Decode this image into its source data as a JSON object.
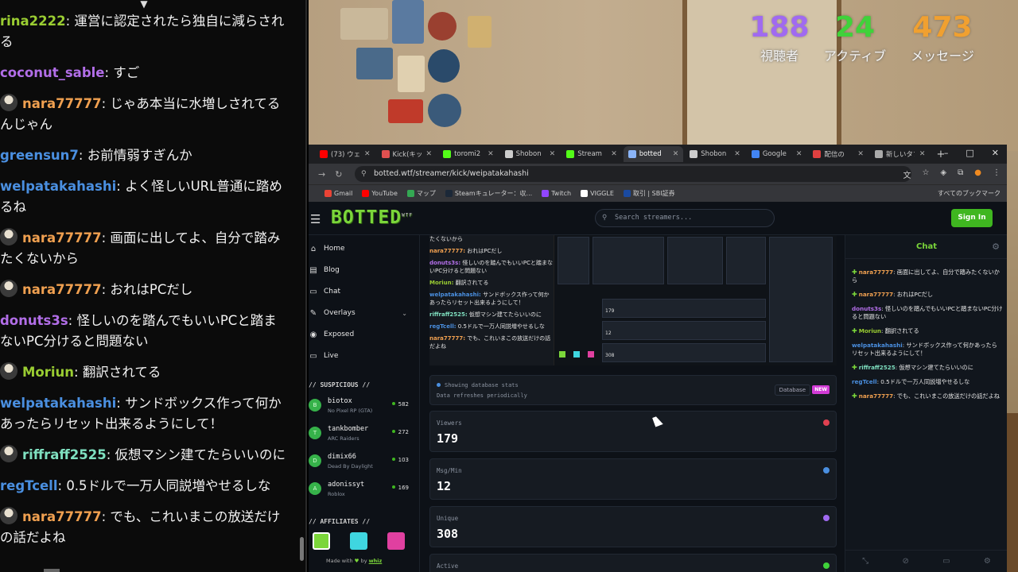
{
  "stream_chat": {
    "messages": [
      {
        "user": "rina2222",
        "color": "#9acd32",
        "avatar": false,
        "text": "運営に認定されたら独自に減らされる"
      },
      {
        "user": "coconut_sable",
        "color": "#b26ee8",
        "avatar": false,
        "text": "すご"
      },
      {
        "user": "nara77777",
        "color": "#f0a050",
        "avatar": true,
        "text": "じゃあ本当に水増しされてるんじゃん"
      },
      {
        "user": "greensun7",
        "color": "#4a8fe0",
        "avatar": false,
        "text": "お前情弱すぎんか"
      },
      {
        "user": "welpatakahashi",
        "color": "#4a8fe0",
        "avatar": false,
        "text": "よく怪しいURL普通に踏めるね"
      },
      {
        "user": "nara77777",
        "color": "#f0a050",
        "avatar": true,
        "text": "画面に出してよ、自分で踏みたくないから"
      },
      {
        "user": "nara77777",
        "color": "#f0a050",
        "avatar": true,
        "text": "おれはPCだし"
      },
      {
        "user": "donuts3s",
        "color": "#b26ee8",
        "avatar": false,
        "text": "怪しいのを踏んでもいいPCと踏まないPC分けると問題ない"
      },
      {
        "user": "Moriun",
        "color": "#9acd32",
        "avatar": true,
        "text": "翻訳されてる"
      },
      {
        "user": "welpatakahashi",
        "color": "#4a8fe0",
        "avatar": false,
        "text": "サンドボックス作って何かあったらリセット出来るようにして！"
      },
      {
        "user": "riffraff2525",
        "color": "#7fe0c0",
        "avatar": true,
        "text": "仮想マシン建てたらいいのに"
      },
      {
        "user": "regTcell",
        "color": "#4a8fe0",
        "avatar": false,
        "text": "0.5ドルで一万人同説増やせるしな"
      },
      {
        "user": "nara77777",
        "color": "#f0a050",
        "avatar": true,
        "text": "でも、これいまこの放送だけの話だよね"
      }
    ]
  },
  "overlay_stats": [
    {
      "value": "188",
      "label": "視聴者",
      "color": "#a06af0"
    },
    {
      "value": "24",
      "label": "アクティブ",
      "color": "#3fd23a"
    },
    {
      "value": "473",
      "label": "メッセージ",
      "color": "#f0a030"
    }
  ],
  "browser": {
    "tabs": [
      {
        "label": "(73) ウェ",
        "icon_color": "#ff0000",
        "active": false
      },
      {
        "label": "Kick(キッ",
        "icon_color": "#e05050",
        "active": false
      },
      {
        "label": "toromi2",
        "icon_color": "#53fc18",
        "active": false
      },
      {
        "label": "Shobon",
        "icon_color": "#cccccc",
        "active": false
      },
      {
        "label": "Stream",
        "icon_color": "#53fc18",
        "active": false
      },
      {
        "label": "botted",
        "icon_color": "#8ab4f8",
        "active": true
      },
      {
        "label": "Shobon",
        "icon_color": "#cccccc",
        "active": false
      },
      {
        "label": "Google",
        "icon_color": "#4285f4",
        "active": false
      },
      {
        "label": "配信の",
        "icon_color": "#e04040",
        "active": false
      },
      {
        "label": "新しいタブ",
        "icon_color": "#aaaaaa",
        "active": false
      }
    ],
    "new_tab": "+",
    "window_controls": [
      "–",
      "□",
      "✕"
    ],
    "url": "botted.wtf/streamer/kick/weipatakahashi",
    "bookmarks": [
      {
        "label": "Gmail",
        "icon_color": "#ea4335"
      },
      {
        "label": "YouTube",
        "icon_color": "#ff0000"
      },
      {
        "label": "マップ",
        "icon_color": "#34a853"
      },
      {
        "label": "Steamキュレーター：収...",
        "icon_color": "#1b2838"
      },
      {
        "label": "Twitch",
        "icon_color": "#9146ff"
      },
      {
        "label": "VIGGLE",
        "icon_color": "#ffffff"
      },
      {
        "label": "取引 | SBI証券",
        "icon_color": "#1a4aa0"
      }
    ],
    "all_bookmarks": "すべてのブックマーク"
  },
  "site": {
    "logo": "BOTTED",
    "logo_sup": "WTF",
    "search_placeholder": "Search streamers...",
    "signin": "Sign In",
    "nav": [
      {
        "label": "Home",
        "icon": "home-icon",
        "glyph": "⌂"
      },
      {
        "label": "Blog",
        "icon": "blog-icon",
        "glyph": "▤"
      },
      {
        "label": "Chat",
        "icon": "chat-icon",
        "glyph": "▭"
      },
      {
        "label": "Overlays",
        "icon": "overlays-icon",
        "glyph": "✎"
      },
      {
        "label": "Exposed",
        "icon": "eye-icon",
        "glyph": "◉"
      },
      {
        "label": "Live",
        "icon": "live-icon",
        "glyph": "▭"
      }
    ],
    "suspicious_title": "// SUSPICIOUS //",
    "suspicious": [
      {
        "name": "biotox",
        "game": "No Pixel RP (GTA)",
        "count": "582",
        "initial": "B"
      },
      {
        "name": "tankbomber",
        "game": "ARC Raiders",
        "count": "272",
        "initial": "T"
      },
      {
        "name": "dimix66",
        "game": "Dead By Daylight",
        "count": "103",
        "initial": "D"
      },
      {
        "name": "adonissyt",
        "game": "Roblox",
        "count": "169",
        "initial": "A"
      }
    ],
    "affiliates_title": "// AFFILIATES //",
    "swatches": [
      "#7bd63a",
      "#3fd6e0",
      "#e040a0"
    ],
    "made_with": "Made with",
    "heart": "♥",
    "by": "by",
    "author": "whiz",
    "preview_chat": [
      {
        "user": "",
        "color": "#e6e6e6",
        "text": "たくないから"
      },
      {
        "user": "nara77777:",
        "color": "#f0a050",
        "text": "おれはPCだし"
      },
      {
        "user": "donuts3s:",
        "color": "#b26ee8",
        "text": "怪しいのを踏んでもいいPCと踏まないPC分けると問題ない"
      },
      {
        "user": "Moriun:",
        "color": "#9acd32",
        "text": "翻訳されてる"
      },
      {
        "user": "welpatakahashi:",
        "color": "#4a8fe0",
        "text": "サンドボックス作って何かあったらリセット出来るようにして！"
      },
      {
        "user": "riffraff2525:",
        "color": "#7fe0c0",
        "text": "仮想マシン建てたらいいのに"
      },
      {
        "user": "regTcell:",
        "color": "#4a8fe0",
        "text": "0.5ドルで一万人同説増やせるしな"
      },
      {
        "user": "nara77777:",
        "color": "#f0a050",
        "text": "でも、これいまこの放送だけの話だよね"
      }
    ],
    "preview_values": [
      "179",
      "12",
      "308"
    ],
    "db_line1": "Showing database stats",
    "db_line2": "Data refreshes periodically",
    "db_button": "Database",
    "db_badge": "NEW",
    "metrics": [
      {
        "label": "Viewers",
        "value": "179",
        "icon": "eye-icon",
        "icon_color": "#e04050"
      },
      {
        "label": "Msg/Min",
        "value": "12",
        "icon": "message-icon",
        "icon_color": "#4a8fe0"
      },
      {
        "label": "Unique",
        "value": "308",
        "icon": "users-icon",
        "icon_color": "#a06af0"
      },
      {
        "label": "Active",
        "value": "",
        "icon": "check-icon",
        "icon_color": "#3fd23a"
      }
    ],
    "chat": {
      "title": "Chat",
      "messages": [
        {
          "user": "nara77777",
          "color": "#f0a050",
          "text": "画面に出してよ、自分で踏みたくないから",
          "badge": true
        },
        {
          "user": "nara77777",
          "color": "#f0a050",
          "text": "おれはPCだし",
          "badge": true
        },
        {
          "user": "donuts3s",
          "color": "#b26ee8",
          "text": "怪しいのを踏んでもいいPCと踏まないPC分けると問題ない",
          "badge": false
        },
        {
          "user": "Moriun",
          "color": "#9acd32",
          "text": "翻訳されてる",
          "badge": true
        },
        {
          "user": "welpatakahashi",
          "color": "#4a8fe0",
          "text": "サンドボックス作って何かあったらリセット出来るようにして！",
          "badge": false
        },
        {
          "user": "riffraff2525",
          "color": "#7fe0c0",
          "text": "仮想マシン建てたらいいのに",
          "badge": true
        },
        {
          "user": "regTcell",
          "color": "#4a8fe0",
          "text": "0.5ドルで一万人同説増やせるしな",
          "badge": false
        },
        {
          "user": "nara77777",
          "color": "#f0a050",
          "text": "でも、これいまこの放送だけの話だよね",
          "badge": true
        }
      ]
    }
  }
}
